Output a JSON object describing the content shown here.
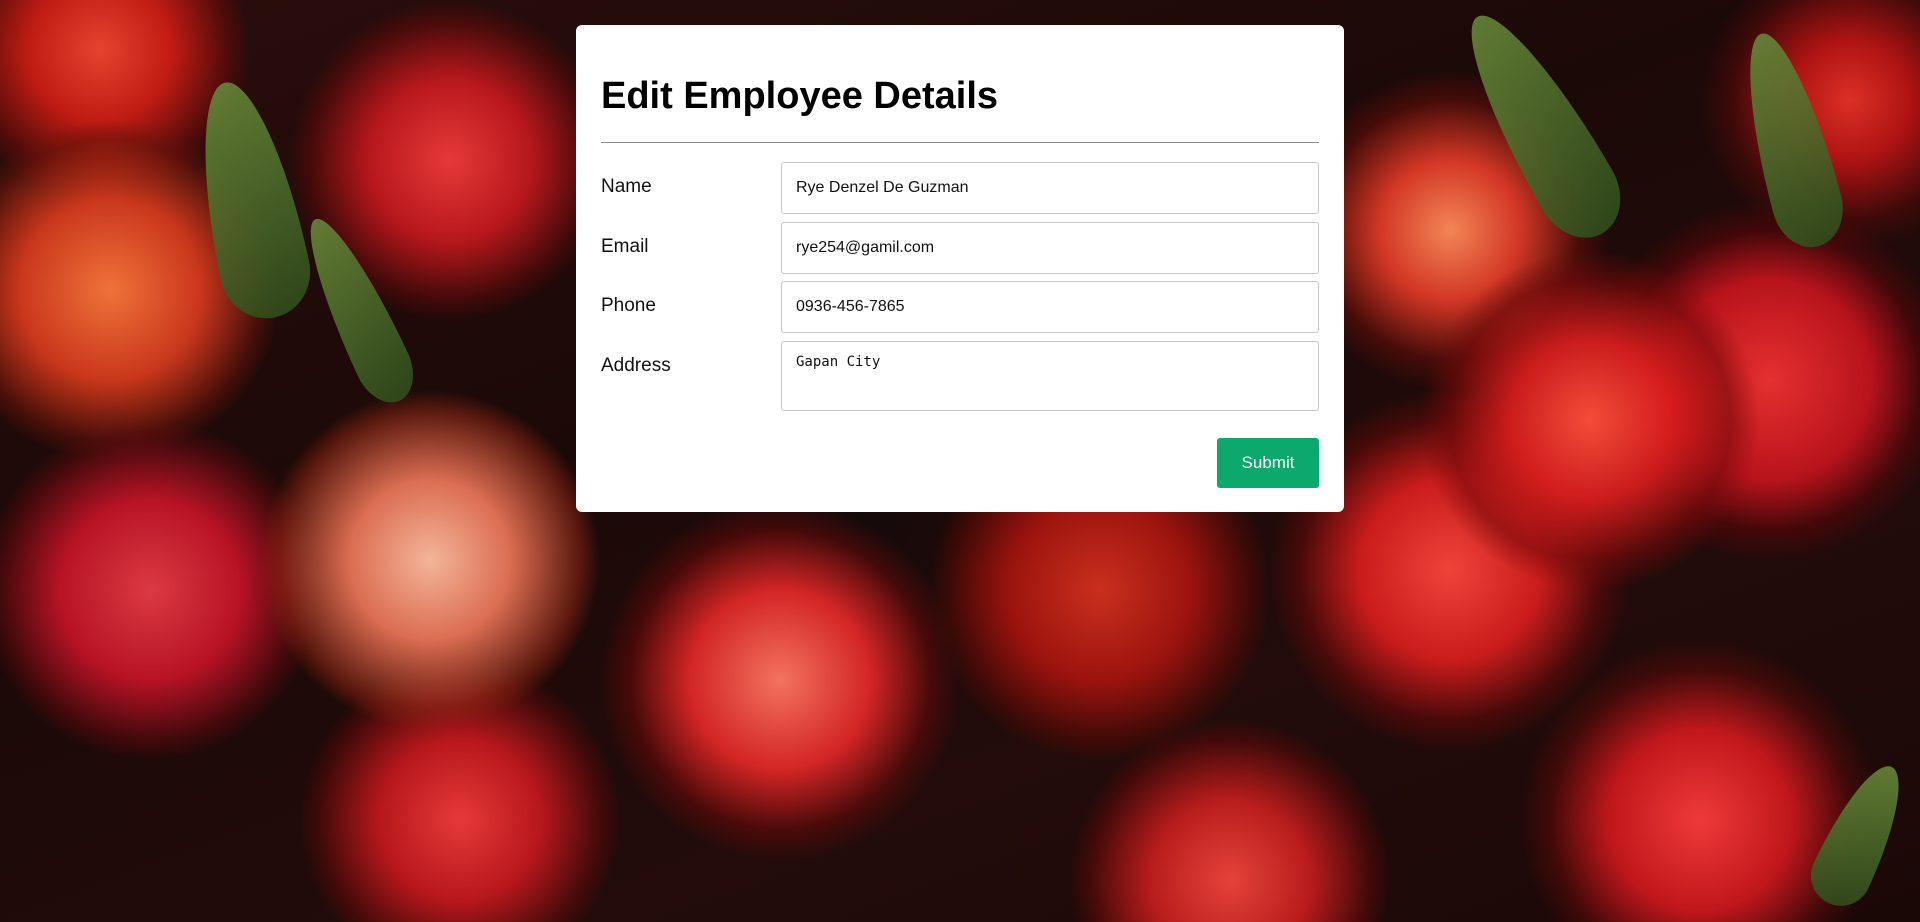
{
  "page": {
    "title": "Edit Employee Details"
  },
  "form": {
    "fields": [
      {
        "label": "Name",
        "value": "Rye Denzel De Guzman"
      },
      {
        "label": "Email",
        "value": "rye254@gamil.com"
      },
      {
        "label": "Phone",
        "value": "0936-456-7865"
      },
      {
        "label": "Address",
        "value": "Gapan City"
      }
    ],
    "submit_label": "Submit"
  },
  "colors": {
    "submit_button": "#0ca86d",
    "card": "#ffffff"
  }
}
